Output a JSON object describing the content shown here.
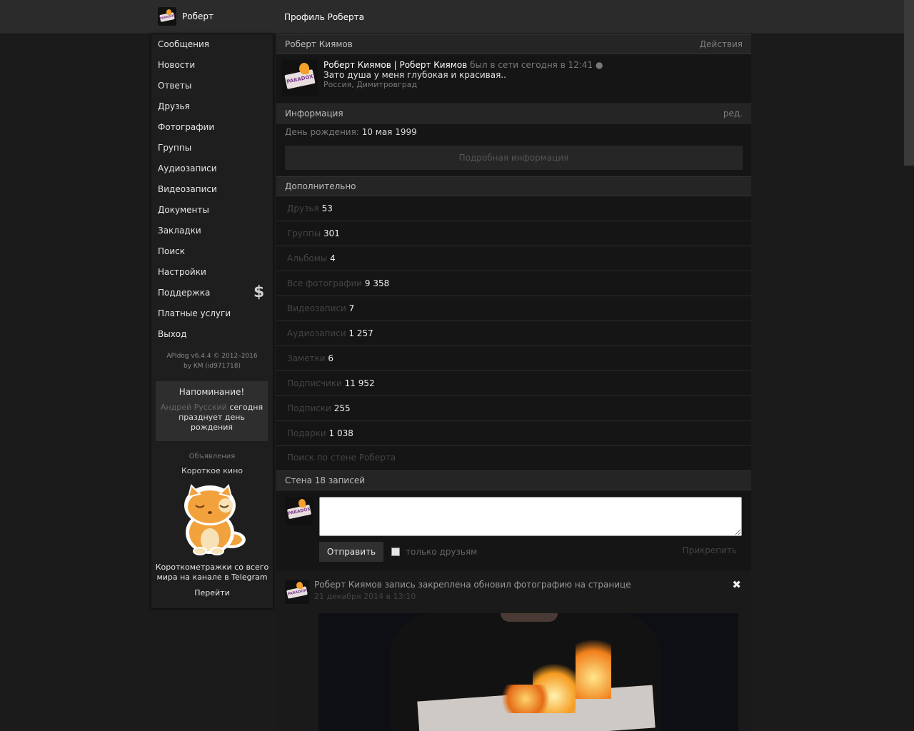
{
  "header": {
    "user_name": "Роберт",
    "page_title": "Профиль Роберта"
  },
  "sidebar": {
    "items": [
      {
        "label": "Сообщения"
      },
      {
        "label": "Новости"
      },
      {
        "label": "Ответы"
      },
      {
        "label": "Друзья"
      },
      {
        "label": "Фотографии"
      },
      {
        "label": "Группы"
      },
      {
        "label": "Аудиозаписи"
      },
      {
        "label": "Видеозаписи"
      },
      {
        "label": "Документы"
      },
      {
        "label": "Закладки"
      },
      {
        "label": "Поиск"
      },
      {
        "label": "Настройки"
      },
      {
        "label": "Поддержка"
      },
      {
        "label": "Платные услуги"
      },
      {
        "label": "Выход"
      }
    ],
    "dollar_icon": "$",
    "copyright_line1": "APIdog v6.4.4 © 2012–2016",
    "copyright_line2": "by KM (id971718)",
    "reminder": {
      "title": "Напоминание!",
      "person": "Андрей Русский",
      "text": "сегодня празднует день рождения"
    },
    "ads": {
      "label": "Объявления",
      "title": "Короткое кино",
      "text": "Короткометражки со всего мира на канале в Telegram",
      "link": "Перейти"
    }
  },
  "profile": {
    "section_title": "Роберт Киямов",
    "actions_label": "Действия",
    "full_name": "Роберт Киямов | Роберт Киямов",
    "online": "был в сети сегодня в 12:41",
    "status": "Зато душа у меня глубокая и красивая..",
    "location": "Россия, Димитровград",
    "avatar_text": "PARADOX"
  },
  "info": {
    "section_title": "Информация",
    "edit_label": "ред.",
    "birthday_label": "День рождения:",
    "birthday_value": "10 мая 1999",
    "more_button": "Подробная информация"
  },
  "extra": {
    "section_title": "Дополнительно",
    "stats": [
      {
        "label": "Друзья",
        "value": "53"
      },
      {
        "label": "Группы",
        "value": "301"
      },
      {
        "label": "Альбомы",
        "value": "4"
      },
      {
        "label": "Все фотографии",
        "value": "9 358"
      },
      {
        "label": "Видеозаписи",
        "value": "7"
      },
      {
        "label": "Аудиозаписи",
        "value": "1 257"
      },
      {
        "label": "Заметки",
        "value": "6"
      },
      {
        "label": "Подписчики",
        "value": "11 952"
      },
      {
        "label": "Подписки",
        "value": "255"
      },
      {
        "label": "Подарки",
        "value": "1 038"
      }
    ],
    "wall_search": "Поиск по стене Роберта"
  },
  "wall": {
    "section_title": "Стена 18 записей",
    "input_value": "",
    "send_button": "Отправить",
    "only_friends": "только друзьям",
    "attach": "Прикрепить",
    "post": {
      "header": "Роберт Киямов запись закреплена обновил фотографию на странице",
      "date": "21 декабря 2014 в 13:10",
      "close": "✖"
    }
  }
}
